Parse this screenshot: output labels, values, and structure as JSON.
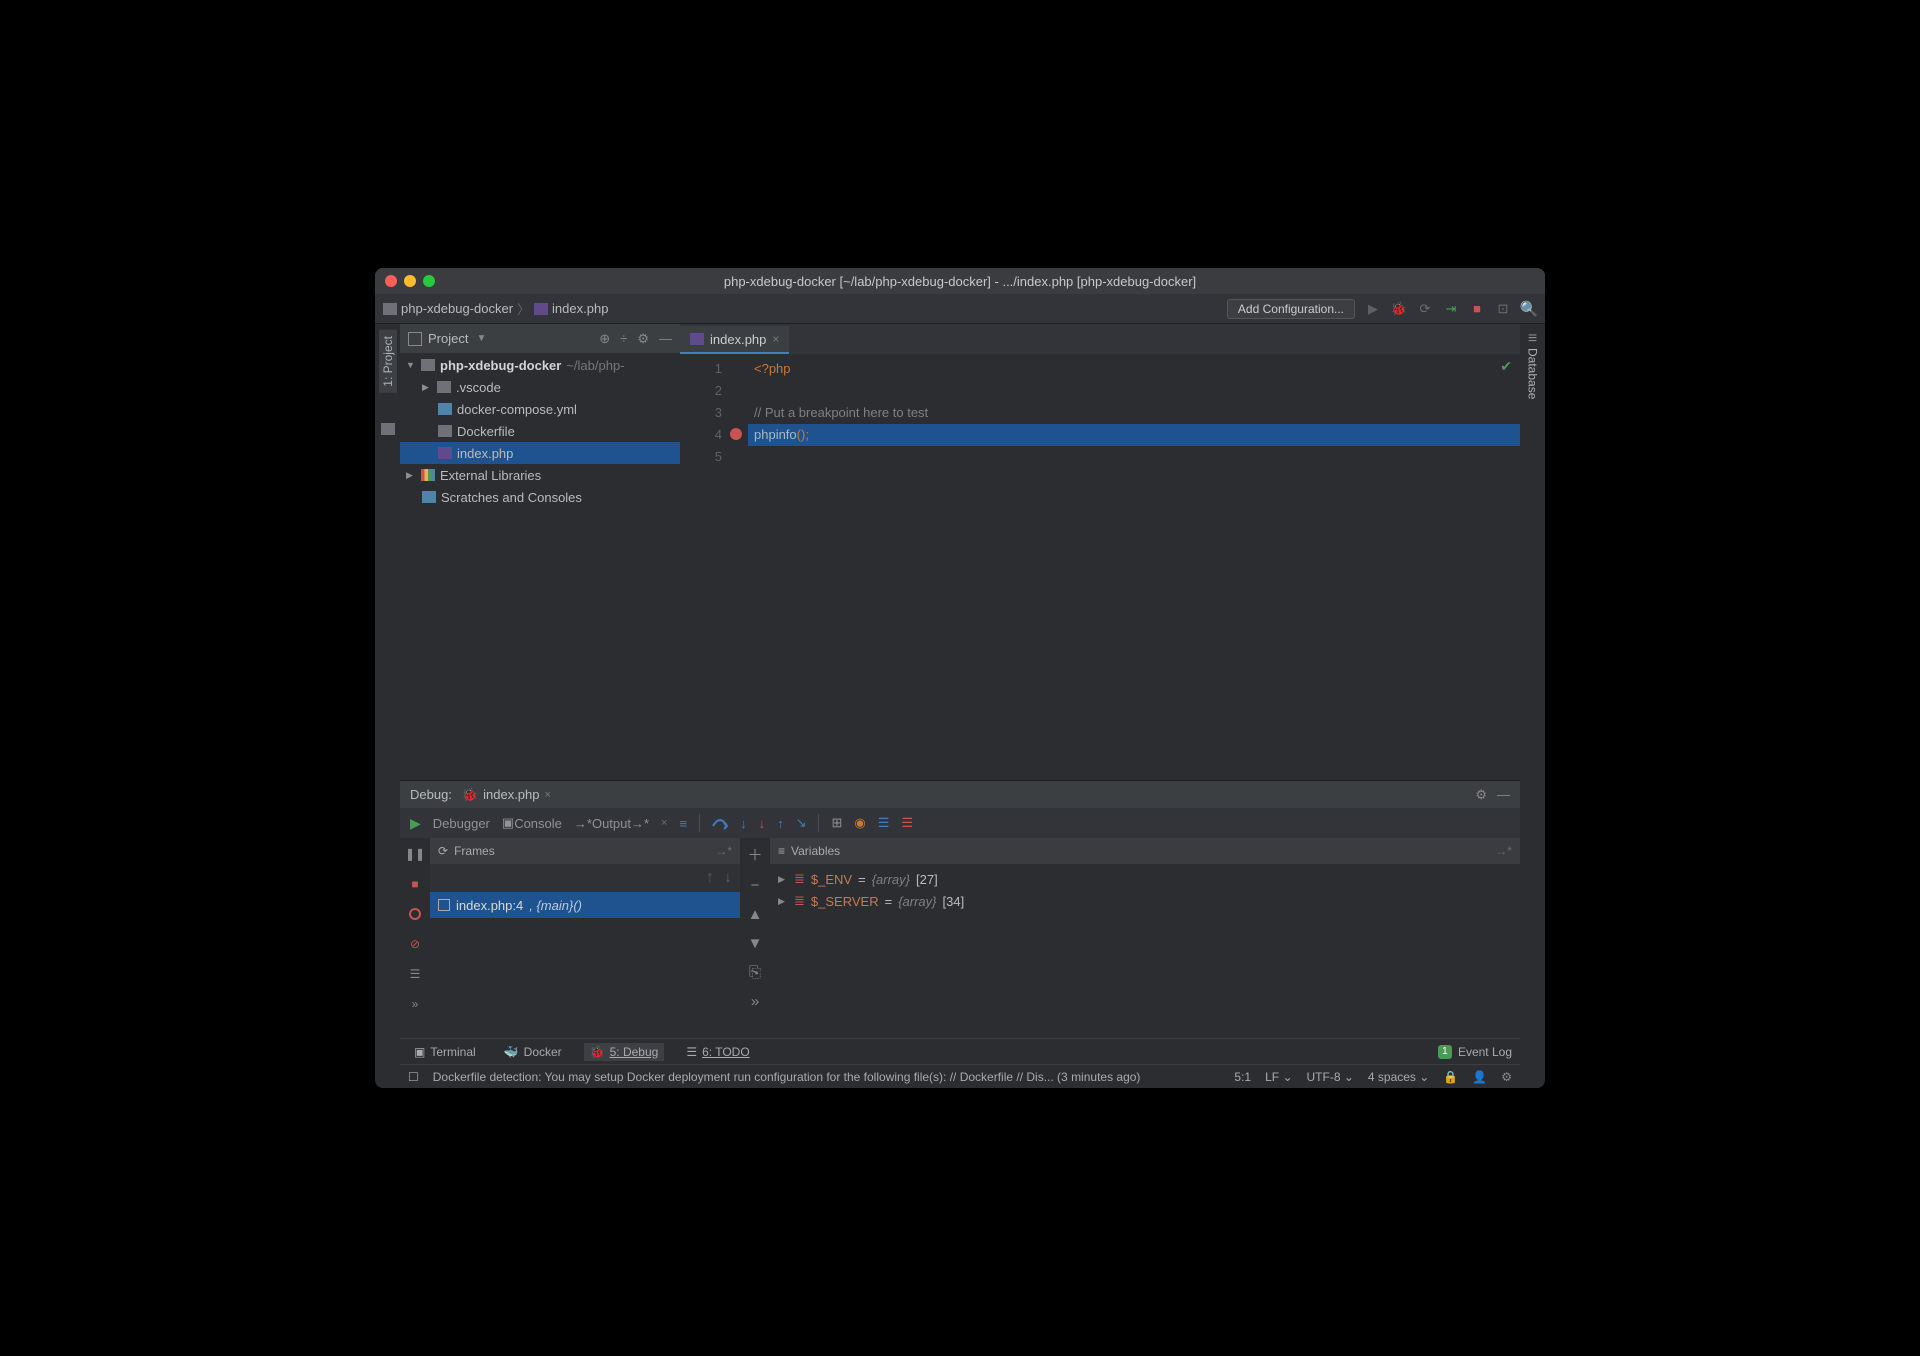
{
  "titlebar": {
    "title": "php-xdebug-docker [~/lab/php-xdebug-docker] - .../index.php [php-xdebug-docker]"
  },
  "breadcrumbs": {
    "root": "php-xdebug-docker",
    "file": "index.php"
  },
  "toolbar": {
    "add_config": "Add Configuration..."
  },
  "sidebar_left": {
    "project": "1: Project"
  },
  "sidebar_right": {
    "database": "Database"
  },
  "project_pane": {
    "label": "Project"
  },
  "tree": {
    "root": {
      "name": "php-xdebug-docker",
      "path": "~/lab/php-"
    },
    "children": [
      {
        "name": ".vscode",
        "type": "folder"
      },
      {
        "name": "docker-compose.yml",
        "type": "yml"
      },
      {
        "name": "Dockerfile",
        "type": "file"
      },
      {
        "name": "index.php",
        "type": "php",
        "selected": true
      }
    ],
    "external": "External Libraries",
    "scratches": "Scratches and Consoles"
  },
  "editor": {
    "tab": "index.php",
    "lines": [
      "1",
      "2",
      "3",
      "4",
      "5"
    ],
    "code": {
      "l1": "<?php",
      "l3": "// Put a breakpoint here to test",
      "l4a": "phpinfo",
      "l4b": "();"
    }
  },
  "debug": {
    "label": "Debug:",
    "tab": "index.php",
    "debugger": "Debugger",
    "console": "Console",
    "output": "Output",
    "frames_label": "Frames",
    "vars_label": "Variables",
    "frame": {
      "file": "index.php:4",
      "ctx": ", {main}()"
    },
    "vars": [
      {
        "name": "$_ENV",
        "type": "{array}",
        "size": "[27]"
      },
      {
        "name": "$_SERVER",
        "type": "{array}",
        "size": "[34]"
      }
    ]
  },
  "bottom": {
    "terminal": "Terminal",
    "docker": "Docker",
    "debug": "5: Debug",
    "todo": "6: TODO",
    "event_log": "Event Log",
    "event_count": "1"
  },
  "status": {
    "msg": "Dockerfile detection: You may setup Docker deployment run configuration for the following file(s): // Dockerfile // Dis... (3 minutes ago)",
    "pos": "5:1",
    "le": "LF",
    "enc": "UTF-8",
    "indent": "4 spaces"
  }
}
